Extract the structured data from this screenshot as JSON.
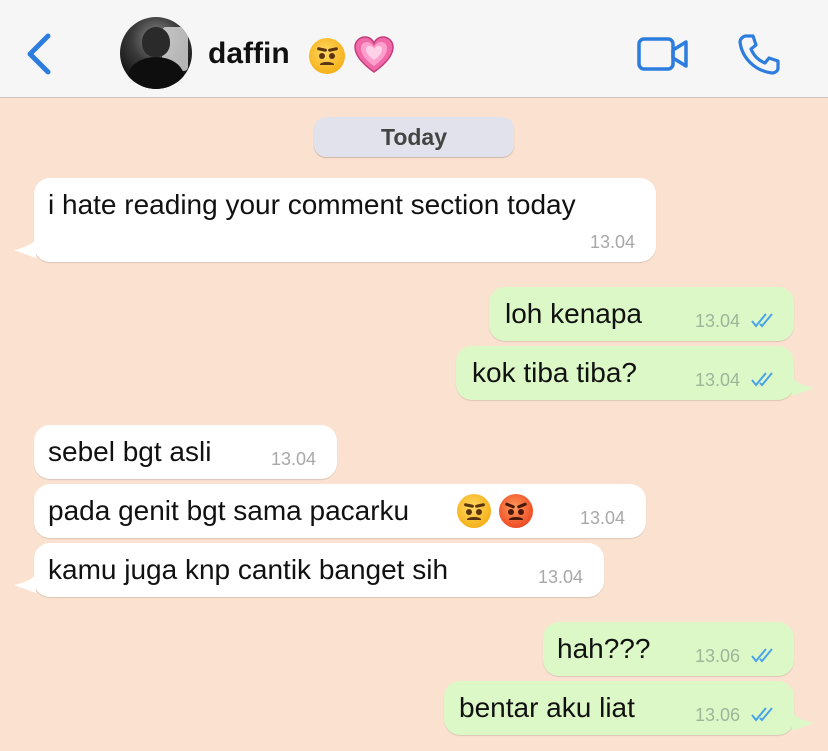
{
  "header": {
    "contact_name": "daffin",
    "emojis": [
      "annoyed-face-emoji",
      "growing-heart-emoji"
    ],
    "accent_color": "#2d7ddf"
  },
  "date_divider": "Today",
  "messages": [
    {
      "direction": "in",
      "text": "i hate reading your comment section today",
      "time": "13.04"
    },
    {
      "direction": "out",
      "text": "loh kenapa",
      "time": "13.04",
      "status": "read"
    },
    {
      "direction": "out",
      "text": "kok tiba tiba?",
      "time": "13.04",
      "status": "read"
    },
    {
      "direction": "in",
      "text": "sebel bgt asli",
      "time": "13.04"
    },
    {
      "direction": "in",
      "text": "pada genit bgt sama pacarku",
      "time": "13.04",
      "emojis": [
        "annoyed-face-emoji",
        "angry-face-emoji"
      ]
    },
    {
      "direction": "in",
      "text": "kamu juga knp cantik banget sih",
      "time": "13.04"
    },
    {
      "direction": "out",
      "text": "hah???",
      "time": "13.06",
      "status": "read"
    },
    {
      "direction": "out",
      "text": "bentar aku liat",
      "time": "13.06",
      "status": "read"
    }
  ],
  "colors": {
    "chat_background": "#fbe2d0",
    "incoming_bubble": "#ffffff",
    "outgoing_bubble": "#dcf8c7",
    "read_ticks": "#4aa3e8"
  }
}
